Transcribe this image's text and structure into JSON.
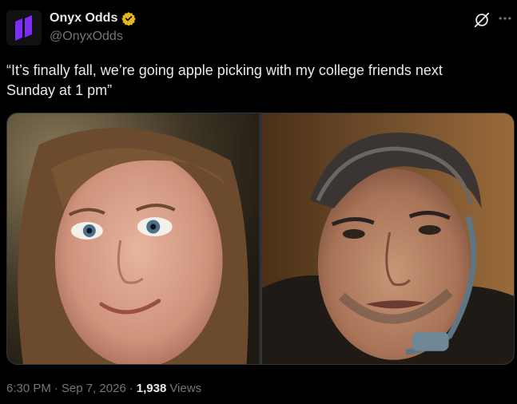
{
  "author": {
    "display_name": "Onyx Odds",
    "handle": "@OnyxOdds",
    "verified": true,
    "avatar_color": "#7b2cf5"
  },
  "tweet": {
    "text": "“It’s finally fall, we’re going apple picking with my college friends next\nSunday at 1 pm”"
  },
  "media": {
    "count": 2,
    "images": [
      {
        "alt": "woman-smiling-photo"
      },
      {
        "alt": "man-with-headset-photo"
      }
    ]
  },
  "meta": {
    "time": "6:30 PM",
    "date": "Sep 7, 2026",
    "sep1": "·",
    "sep2": "·",
    "views_count": "1,938",
    "views_label": "Views"
  },
  "colors": {
    "background": "#000000",
    "text_primary": "#e7e9ea",
    "text_secondary": "#71767b",
    "verified_badge": "#e2b719"
  }
}
